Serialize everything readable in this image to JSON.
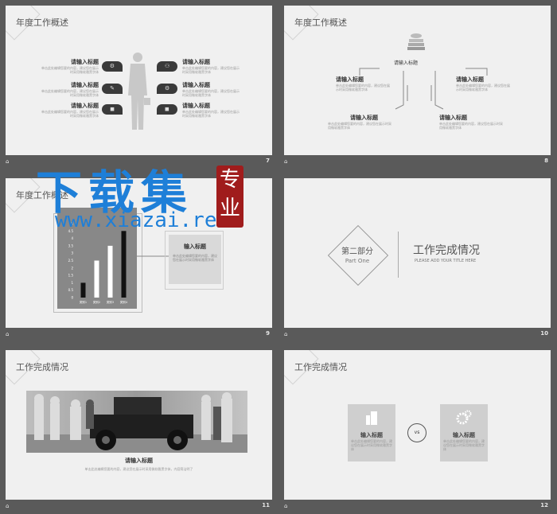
{
  "slides": {
    "s7": {
      "title": "年度工作概述",
      "page": "7",
      "items": [
        {
          "heading": "请输入标题",
          "body": "单击此处编辑您要的内容，建议您在展示时采用微软雅黑字体"
        },
        {
          "heading": "请输入标题",
          "body": "单击此处编辑您要的内容，建议您在展示时采用微软雅黑字体"
        },
        {
          "heading": "请输入标题",
          "body": "单击此处编辑您要的内容，建议您在展示时采用微软雅黑字体"
        },
        {
          "heading": "请输入标题",
          "body": "单击此处编辑您要的内容，建议您在展示时采用微软雅黑字体"
        },
        {
          "heading": "请输入标题",
          "body": "单击此处编辑您要的内容，建议您在展示时采用微软雅黑字体"
        },
        {
          "heading": "请输入标题",
          "body": "单击此处编辑您要的内容，建议您在展示时采用微软雅黑字体"
        }
      ],
      "bubble_icons": [
        "⚙",
        "✎",
        "◼",
        "⚇",
        "⚙",
        "◼"
      ]
    },
    "s8": {
      "page": "8",
      "center": "请输入标题",
      "blocks": [
        {
          "heading": "请输入标题",
          "body": "单击此处编辑您要的内容，建议您在展示时采用微软雅黑字体"
        },
        {
          "heading": "请输入标题",
          "body": "单击此处编辑您要的内容，建议您在展示时采用微软雅黑字体"
        },
        {
          "heading": "请输入标题",
          "body": "单击此处编辑您要的内容，建议您在展示时采用微软雅黑字体"
        },
        {
          "heading": "请输入标题",
          "body": "单击此处编辑您要的内容，建议您在展示时采用微软雅黑字体"
        }
      ]
    },
    "s9": {
      "title": "年度工作概述",
      "page": "9",
      "box_heading": "输入标题",
      "box_body": "单击此处编辑您要的内容，建议您在展示时采用微软雅黑字体"
    },
    "s10": {
      "page": "10",
      "part_cn": "第二部分",
      "part_en": "Part One",
      "heading": "工作完成情况",
      "sub": "PLEASE ADD YOUR TITLE HERE"
    },
    "s11": {
      "title": "工作完成情况",
      "page": "11",
      "heading": "请输入标题",
      "body": "单击此处编辑您要的内容，建议您在展示时采用微软雅黑字体，内容简洁明了"
    },
    "s12": {
      "title": "工作完成情况",
      "page": "12",
      "vs": "vs",
      "left_heading": "输入标题",
      "right_heading": "输入标题",
      "left_body": "单击此处编辑您要的内容，建议您在展示时采用微软雅黑字体",
      "right_body": "单击此处编辑您要的内容，建议您在展示时采用微软雅黑字体"
    }
  },
  "footer_icon": "⌂",
  "watermark": {
    "big": "下载集",
    "url": "www.xiazai.red",
    "seal": "专业"
  },
  "chart_data": {
    "type": "bar",
    "categories": [
      "类别1",
      "类别2",
      "类别3",
      "类别4"
    ],
    "values": [
      1.0,
      2.5,
      3.5,
      4.5
    ],
    "ylim": [
      0,
      5
    ],
    "yticks": [
      "5",
      "4.5",
      "4",
      "3.5",
      "3",
      "2.5",
      "2",
      "1.5",
      "1",
      "0.5",
      "0"
    ],
    "colors": [
      "#111111",
      "#ffffff",
      "#ffffff",
      "#111111"
    ]
  }
}
